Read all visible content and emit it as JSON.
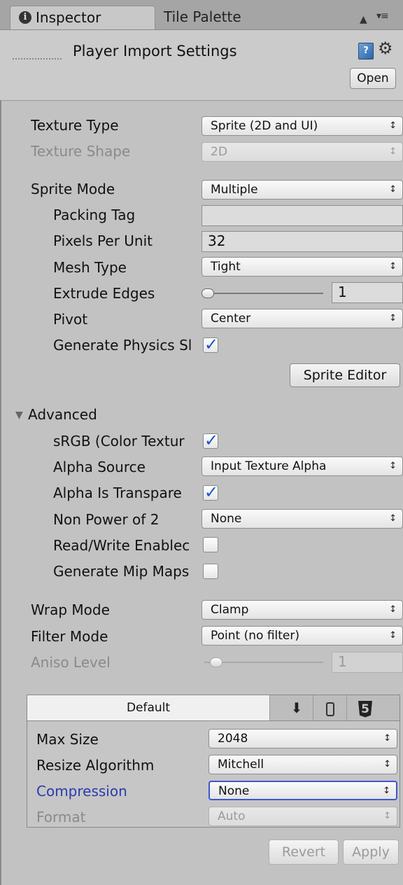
{
  "tabs": {
    "inspector": "Inspector",
    "tile_palette": "Tile Palette"
  },
  "header": {
    "title": "Player Import Settings",
    "open_label": "Open"
  },
  "fields": {
    "texture_type": {
      "label": "Texture Type",
      "value": "Sprite (2D and UI)"
    },
    "texture_shape": {
      "label": "Texture Shape",
      "value": "2D"
    },
    "sprite_mode": {
      "label": "Sprite Mode",
      "value": "Multiple"
    },
    "packing_tag": {
      "label": "Packing Tag",
      "value": ""
    },
    "pixels_per_unit": {
      "label": "Pixels Per Unit",
      "value": "32"
    },
    "mesh_type": {
      "label": "Mesh Type",
      "value": "Tight"
    },
    "extrude_edges": {
      "label": "Extrude Edges",
      "value": "1",
      "level": 0
    },
    "pivot": {
      "label": "Pivot",
      "value": "Center"
    },
    "generate_physics": {
      "label": "Generate Physics Sl",
      "checked": true
    },
    "sprite_editor_label": "Sprite Editor"
  },
  "advanced": {
    "label": "Advanced",
    "srgb": {
      "label": "sRGB (Color Textur",
      "checked": true
    },
    "alpha_source": {
      "label": "Alpha Source",
      "value": "Input Texture Alpha"
    },
    "alpha_transparency": {
      "label": "Alpha Is Transpare",
      "checked": true
    },
    "non_power_of_2": {
      "label": "Non Power of 2",
      "value": "None"
    },
    "read_write": {
      "label": "Read/Write Enablec",
      "checked": false
    },
    "mip_maps": {
      "label": "Generate Mip Maps",
      "checked": false
    }
  },
  "wrap_mode": {
    "label": "Wrap Mode",
    "value": "Clamp"
  },
  "filter_mode": {
    "label": "Filter Mode",
    "value": "Point (no filter)"
  },
  "aniso_level": {
    "label": "Aniso Level",
    "value": "1",
    "level": 0
  },
  "platform": {
    "default_tab": "Default",
    "max_size": {
      "label": "Max Size",
      "value": "2048"
    },
    "resize_algorithm": {
      "label": "Resize Algorithm",
      "value": "Mitchell"
    },
    "compression": {
      "label": "Compression",
      "value": "None"
    },
    "format": {
      "label": "Format",
      "value": "Auto"
    }
  },
  "buttons": {
    "revert": "Revert",
    "apply": "Apply"
  },
  "icons": {
    "info": "info-icon",
    "lock": "lock-icon",
    "menu": "menu-icon",
    "book": "help-book-icon",
    "gear": "gear-icon",
    "download": "download-icon",
    "phone": "phone-icon",
    "html5": "html5-icon"
  },
  "colors": {
    "checkmark": "#1a55c8",
    "focus_border": "#3c58d0",
    "compression_label": "#2a3cb0"
  }
}
